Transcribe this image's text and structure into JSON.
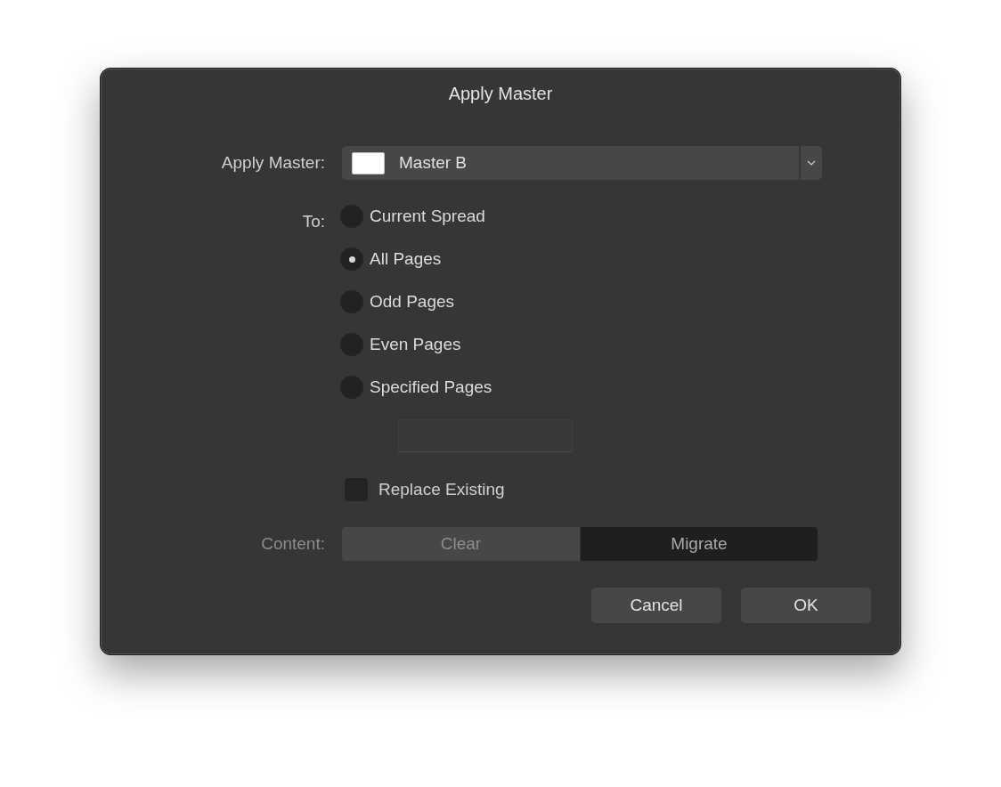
{
  "dialog": {
    "title": "Apply Master"
  },
  "master": {
    "label": "Apply Master:",
    "value": "Master B"
  },
  "target": {
    "label": "To:",
    "options": [
      {
        "label": "Current Spread",
        "selected": false
      },
      {
        "label": "All Pages",
        "selected": true
      },
      {
        "label": "Odd Pages",
        "selected": false
      },
      {
        "label": "Even Pages",
        "selected": false
      },
      {
        "label": "Specified Pages",
        "selected": false
      }
    ]
  },
  "replace_existing": {
    "label": "Replace Existing",
    "checked": false
  },
  "content": {
    "label": "Content:",
    "disabled": true,
    "options": [
      {
        "label": "Clear",
        "selected": false
      },
      {
        "label": "Migrate",
        "selected": true
      }
    ]
  },
  "buttons": [
    {
      "label": "Cancel"
    },
    {
      "label": "OK"
    }
  ]
}
